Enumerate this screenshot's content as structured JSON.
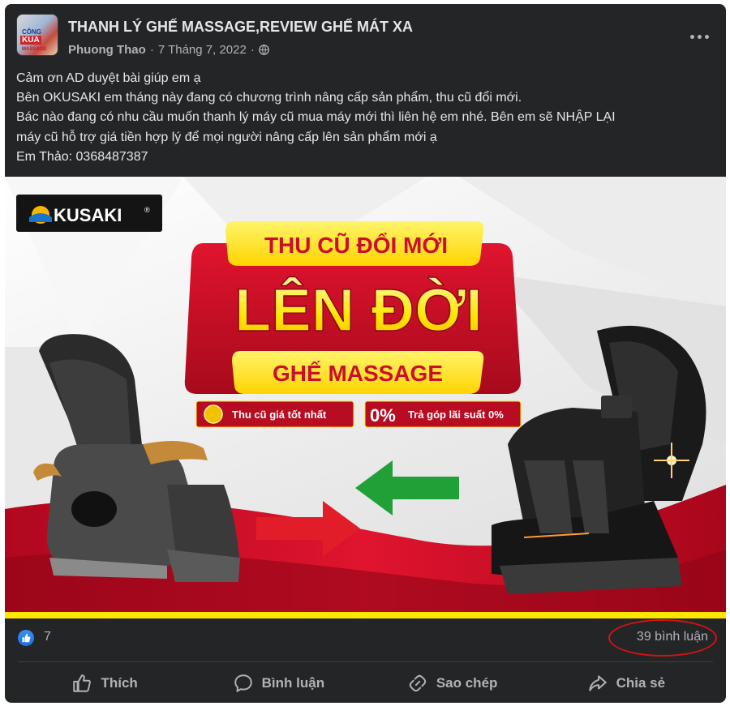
{
  "post": {
    "group_name": "THANH LÝ GHẾ MASSAGE,REVIEW GHẾ MÁT XA",
    "author": "Phuong Thao",
    "separator": "·",
    "date": "7 Tháng 7, 2022",
    "avatar_text": {
      "line1": "CÔNG",
      "line2": "KUA",
      "line3": "MASSAGE"
    },
    "body_lines": [
      "Cảm ơn AD duyệt bài giúp em ạ",
      "Bên OKUSAKI em tháng này đang có chương trình nâng cấp sản phẩm, thu cũ đổi mới.",
      "Bác nào đang có nhu cầu muốn thanh lý máy cũ mua máy mới thì liên hệ em nhé. Bên em sẽ NHẬP LẠI",
      "máy cũ hỗ trợ giá tiền hợp lý để mọi người nâng cấp lên sản phẩm mới ạ",
      "Em Thảo: 0368487387"
    ]
  },
  "banner": {
    "logo_text": "KUSAKI",
    "logo_mark": "®",
    "headline_top": "THU CŨ ĐỔI MỚI",
    "headline_main": "LÊN ĐỜI",
    "headline_bottom": "GHẾ MASSAGE",
    "badge_left": "Thu cũ giá tốt nhất",
    "badge_right_pct": "0%",
    "badge_right": "Trả góp lãi suất 0%",
    "colors": {
      "red": "#c8102e",
      "yellow": "#ffe600",
      "green": "#21a038",
      "dark": "#1c1c1c"
    }
  },
  "stats": {
    "like_count": "7",
    "comment_count": "39 bình luận",
    "highlight_color": "#d11414"
  },
  "actions": [
    {
      "label": "Thích",
      "icon": "thumbs-up-icon"
    },
    {
      "label": "Bình luận",
      "icon": "comment-icon"
    },
    {
      "label": "Sao chép",
      "icon": "link-icon"
    },
    {
      "label": "Chia sẻ",
      "icon": "share-icon"
    }
  ],
  "theme": {
    "card_bg": "#242526",
    "text": "#e4e6eb",
    "muted": "#b0b3b8",
    "like_blue": "#1a6fe0"
  }
}
